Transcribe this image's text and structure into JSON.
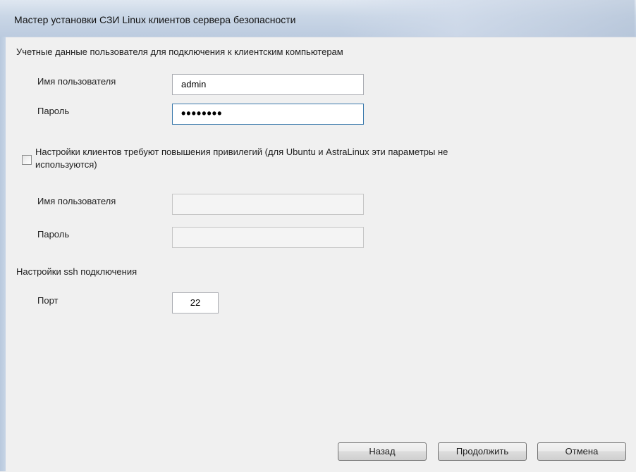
{
  "window": {
    "title": "Мастер установки СЗИ Linux клиентов сервера безопасности"
  },
  "credentials": {
    "section_title": "Учетные данные пользователя для подключения к клиентским компьютерам",
    "username_label": "Имя пользователя",
    "username_value": "admin",
    "password_label": "Пароль",
    "password_value": "••••••••"
  },
  "privileges": {
    "checkbox_label_line1": "Настройки клиентов требуют повышения привилегий (для Ubuntu и AstraLinux эти параметры не",
    "checkbox_label_line2": "используются)",
    "checked": false,
    "username_label": "Имя пользователя",
    "username_value": "",
    "password_label": "Пароль",
    "password_value": ""
  },
  "ssh": {
    "section_title": "Настройки ssh подключения",
    "port_label": "Порт",
    "port_value": "22"
  },
  "buttons": {
    "back_label": "Назад",
    "continue_label": "Продолжить",
    "cancel_label": "Отмена"
  }
}
